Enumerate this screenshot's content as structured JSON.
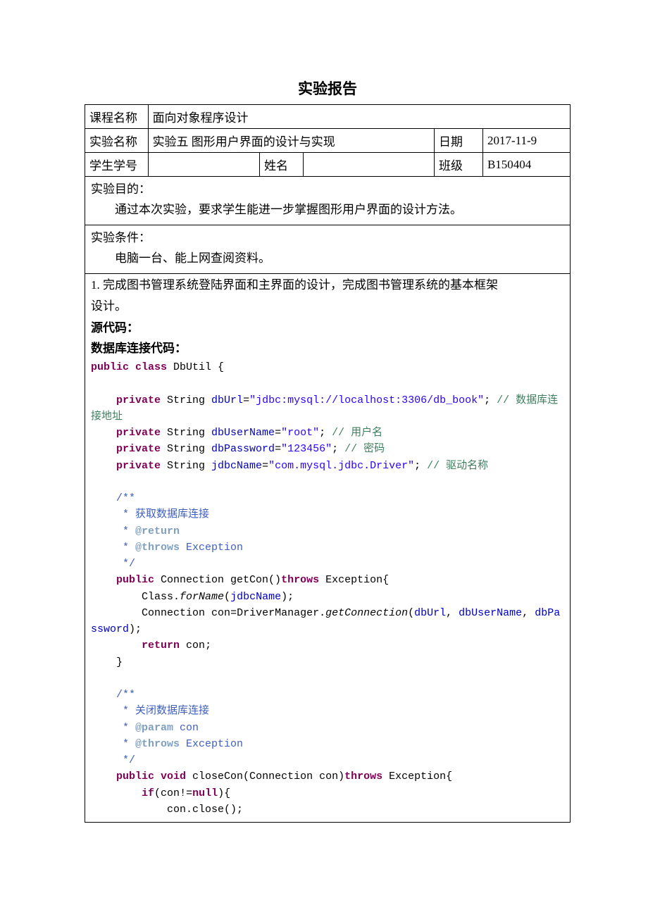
{
  "title": "实验报告",
  "table": {
    "course_label": "课程名称",
    "course_value": "面向对象程序设计",
    "exp_label": "实验名称",
    "exp_value": "实验五 图形用户界面的设计与实现",
    "date_label": "日期",
    "date_value": "2017-11-9",
    "sid_label": "学生学号",
    "sid_value": "",
    "name_label": "姓名",
    "name_value": "",
    "class_label": "班级",
    "class_value": "B150404"
  },
  "purpose": {
    "heading": "实验目的：",
    "body": "通过本次实验，要求学生能进一步掌握图形用户界面的设计方法。"
  },
  "conditions": {
    "heading": "实验条件：",
    "body": "电脑一台、能上网查阅资料。"
  },
  "task": {
    "line1": "1. 完成图书管理系统登陆界面和主界面的设计，完成图书管理系统的基本框架",
    "line2": "设计。",
    "src_label": "源代码：",
    "db_label": "数据库连接代码："
  },
  "code": {
    "t0a": "public class",
    "t0b": " DbUtil {",
    "t1a": "    ",
    "t1b": "private",
    "t1c": " String ",
    "t1d": "dbUrl",
    "t1e": "=",
    "t1f": "\"jdbc:mysql://localhost:3306/db_book\"",
    "t1g": "; ",
    "t1h": "// 数据库连接地址",
    "t2a": "    ",
    "t2b": "private",
    "t2c": " String ",
    "t2d": "dbUserName",
    "t2e": "=",
    "t2f": "\"root\"",
    "t2g": "; ",
    "t2h": "// 用户名",
    "t3a": "    ",
    "t3b": "private",
    "t3c": " String ",
    "t3d": "dbPassword",
    "t3e": "=",
    "t3f": "\"123456\"",
    "t3g": "; ",
    "t3h": "// 密码",
    "t4a": "    ",
    "t4b": "private",
    "t4c": " String ",
    "t4d": "jdbcName",
    "t4e": "=",
    "t4f": "\"com.mysql.jdbc.Driver\"",
    "t4g": "; ",
    "t4h": "// 驱动名称",
    "d1": "    /**",
    "d2": "     * 获取数据库连接",
    "d3a": "     * ",
    "d3b": "@return",
    "d4a": "     * ",
    "d4b": "@throws",
    "d4c": " Exception",
    "d5": "     */",
    "m1a": "    ",
    "m1b": "public",
    "m1c": " Connection getCon()",
    "m1d": "throws",
    "m1e": " Exception{",
    "m2a": "        Class.",
    "m2b": "forName",
    "m2c": "(",
    "m2d": "jdbcName",
    "m2e": ");",
    "m3a": "        Connection ",
    "m3b": "con",
    "m3c": "=DriverManager.",
    "m3d": "getConnection",
    "m3e": "(",
    "m3f": "dbUrl",
    "m3g": ", ",
    "m3h": "dbUserName",
    "m3i": ", ",
    "m3j": "dbPassword",
    "m3k": ");",
    "m4a": "        ",
    "m4b": "return",
    "m4c": " ",
    "m4d": "con",
    "m4e": ";",
    "m5": "    }",
    "e1": "    /**",
    "e2": "     * 关闭数据库连接",
    "e3a": "     * ",
    "e3b": "@param",
    "e3c": " con",
    "e4a": "     * ",
    "e4b": "@throws",
    "e4c": " Exception",
    "e5": "     */",
    "c1a": "    ",
    "c1b": "public void",
    "c1c": " closeCon(Connection ",
    "c1d": "con",
    "c1e": ")",
    "c1f": "throws",
    "c1g": " Exception{",
    "c2a": "        ",
    "c2b": "if",
    "c2c": "(",
    "c2d": "con",
    "c2e": "!=",
    "c2f": "null",
    "c2g": "){",
    "c3a": "            ",
    "c3b": "con",
    "c3c": ".close();"
  }
}
